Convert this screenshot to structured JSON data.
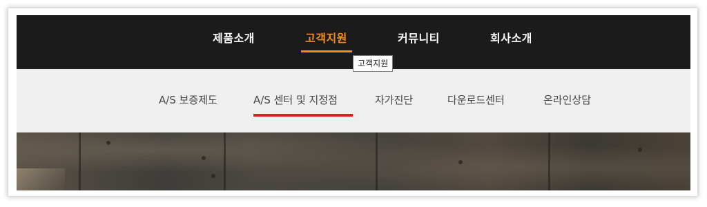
{
  "top_nav": {
    "items": [
      {
        "label": "제품소개",
        "active": false
      },
      {
        "label": "고객지원",
        "active": true
      },
      {
        "label": "커뮤니티",
        "active": false
      },
      {
        "label": "회사소개",
        "active": false
      }
    ],
    "tooltip": "고객지원"
  },
  "sub_nav": {
    "items": [
      {
        "label": "A/S 보증제도",
        "active": false
      },
      {
        "label": "A/S 센터 및 지정점",
        "active": true
      },
      {
        "label": "자가진단",
        "active": false
      },
      {
        "label": "다운로드센터",
        "active": false
      },
      {
        "label": "온라인상담",
        "active": false
      }
    ]
  },
  "colors": {
    "top_nav_bg": "#1b1b1b",
    "active_orange": "#f28d1e",
    "sub_nav_bg": "#efefef",
    "active_red": "#e21d1d"
  },
  "hero": {
    "description_icon": "concrete-wall-image"
  }
}
